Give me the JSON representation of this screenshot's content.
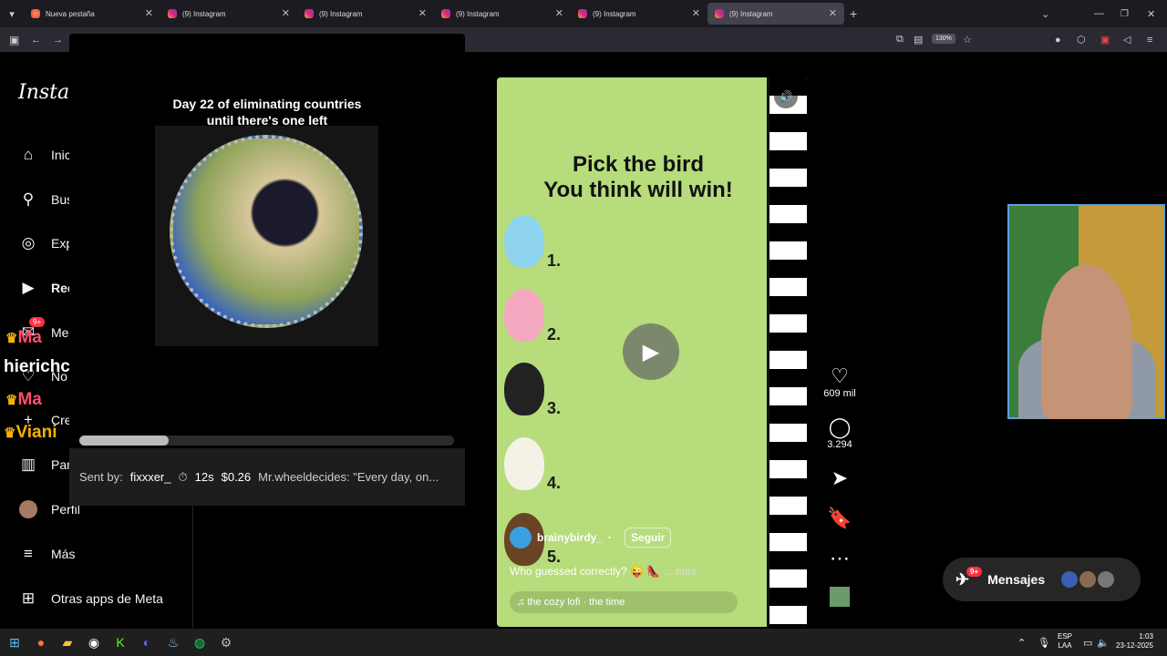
{
  "browser": {
    "tabs": [
      {
        "title": "Nueva pestaña",
        "active": false
      },
      {
        "title": "(9) Instagram",
        "active": false
      },
      {
        "title": "(9) Instagram",
        "active": false
      },
      {
        "title": "(9) Instagram",
        "active": false
      },
      {
        "title": "(9) Instagram",
        "active": false
      },
      {
        "title": "(9) Instagram",
        "active": true
      }
    ],
    "zoom": "130%"
  },
  "sidebar": {
    "logo": "Instag",
    "items": [
      {
        "label": "Inic",
        "icon": "home-icon"
      },
      {
        "label": "Bus",
        "icon": "search-icon"
      },
      {
        "label": "Exp",
        "icon": "compass-icon"
      },
      {
        "label": "Ree",
        "icon": "reels-icon"
      },
      {
        "label": "Me",
        "icon": "messenger-icon"
      },
      {
        "label": "No",
        "icon": "heart-icon"
      },
      {
        "label": "Cre",
        "icon": "plus-icon"
      },
      {
        "label": "Pan",
        "icon": "dashboard-icon"
      },
      {
        "label": "Perfil",
        "icon": "avatar-icon"
      },
      {
        "label": "Más",
        "icon": "menu-icon"
      },
      {
        "label": "Otras apps de Meta",
        "icon": "meta-apps-icon"
      }
    ],
    "badge": "9+"
  },
  "twitch_overlay": {
    "a": "Ma",
    "b": "hierichc",
    "c": "Ma",
    "d": "Viani"
  },
  "overlay": {
    "title_line1": "Day 22 of eliminating countries",
    "title_line2": "until there's one left",
    "sent_by_label": "Sent by:",
    "sent_by": "fixxxer_",
    "duration": "12s",
    "amount": "$0.26",
    "message": "Mr.wheeldecides: \"Every day, on..."
  },
  "reel": {
    "title_line1": "Pick the bird",
    "title_line2": "You think will win!",
    "birds": [
      {
        "num": "1."
      },
      {
        "num": "2."
      },
      {
        "num": "3."
      },
      {
        "num": "4."
      },
      {
        "num": "5."
      }
    ],
    "author": "brainybirdy_",
    "follow": "Seguir",
    "caption": "Who guessed correctly? 😜 👠",
    "more": "... más",
    "music": "the cozy lofi · the time"
  },
  "actions": {
    "likes": "609 mil",
    "comments": "3.294"
  },
  "messages": {
    "label": "Mensajes",
    "badge": "9+"
  },
  "taskbar": {
    "lang1": "ESP",
    "lang2": "LAA",
    "time": "1:03",
    "date": "23-12-2025"
  }
}
